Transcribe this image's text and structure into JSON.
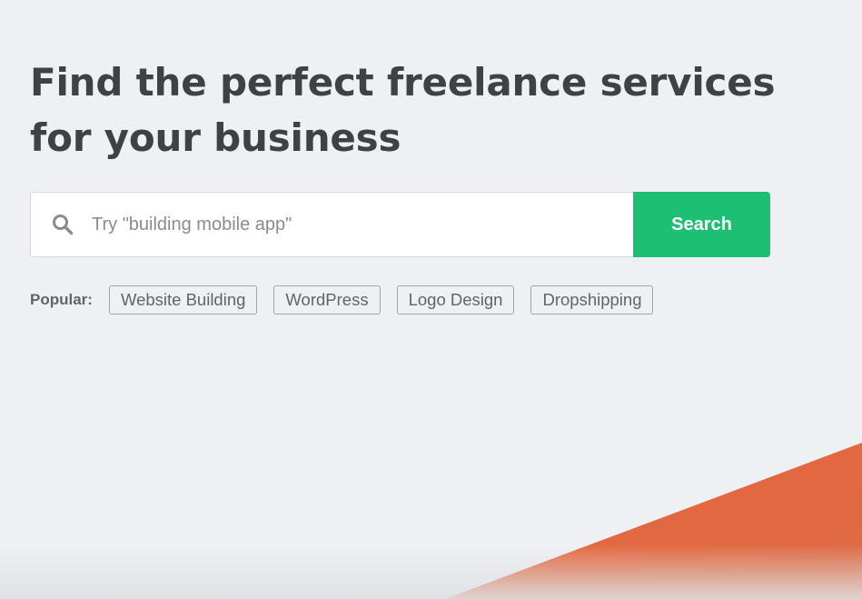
{
  "hero": {
    "title_line1": "Find the perfect freelance services",
    "title_line2": "for your business"
  },
  "search": {
    "placeholder": "Try \"building mobile app\"",
    "button_label": "Search",
    "icon": "search-icon"
  },
  "popular": {
    "label": "Popular:",
    "tags": [
      "Website Building",
      "WordPress",
      "Logo Design",
      "Dropshipping"
    ]
  },
  "colors": {
    "background": "#eef0f3",
    "heading": "#404145",
    "accent_green": "#1dbf73",
    "accent_orange": "#e56a3f"
  }
}
